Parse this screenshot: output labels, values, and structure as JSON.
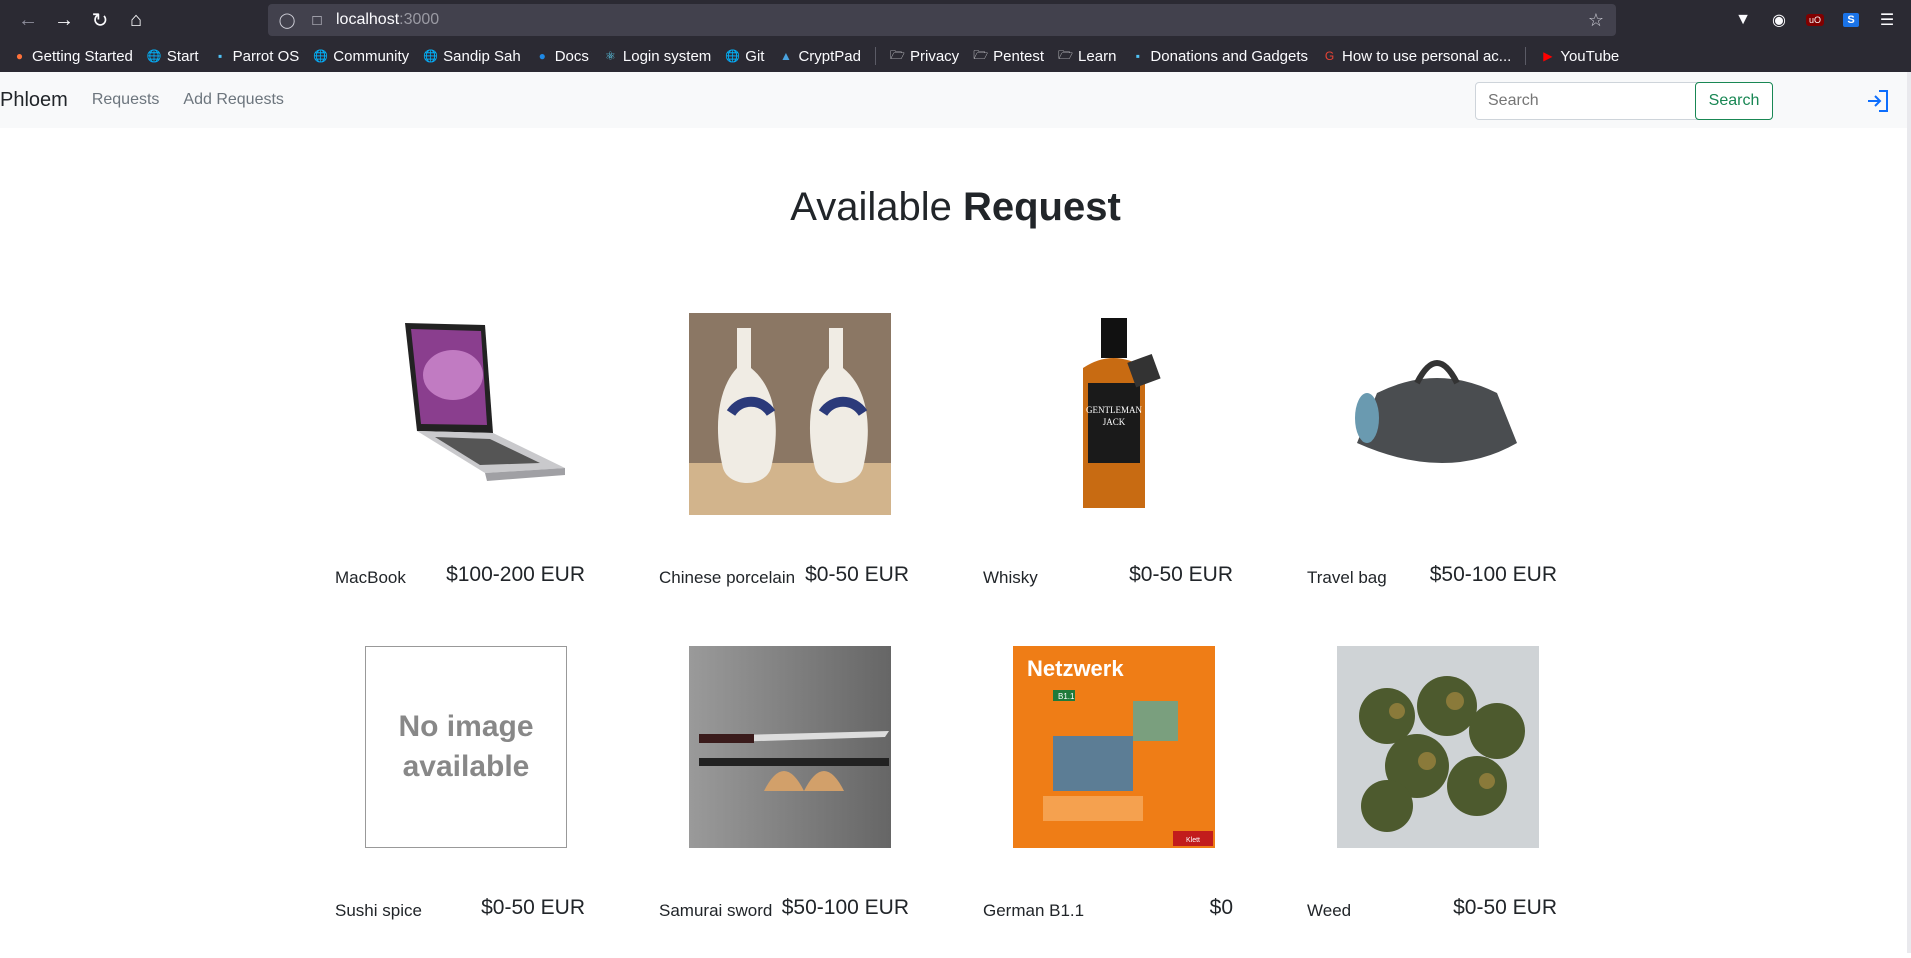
{
  "browser": {
    "url_host": "localhost",
    "url_port": ":3000",
    "bookmarks": [
      {
        "label": "Getting Started",
        "icon": "firefox-icon"
      },
      {
        "label": "Start",
        "icon": "globe-icon"
      },
      {
        "label": "Parrot OS",
        "icon": "parrot-icon"
      },
      {
        "label": "Community",
        "icon": "globe-icon"
      },
      {
        "label": "Sandip Sah",
        "icon": "globe-icon"
      },
      {
        "label": "Docs",
        "icon": "docs-icon"
      },
      {
        "label": "Login system",
        "icon": "react-icon"
      },
      {
        "label": "Git",
        "icon": "globe-icon"
      },
      {
        "label": "CryptPad",
        "icon": "cryptpad-icon"
      },
      {
        "label": "Privacy",
        "icon": "folder-icon"
      },
      {
        "label": "Pentest",
        "icon": "folder-icon"
      },
      {
        "label": "Learn",
        "icon": "folder-icon"
      },
      {
        "label": "Donations and Gadgets",
        "icon": "parrot-icon"
      },
      {
        "label": "How to use personal ac...",
        "icon": "google-icon"
      },
      {
        "label": "YouTube",
        "icon": "youtube-icon"
      }
    ]
  },
  "navbar": {
    "brand": "Phloem",
    "links": [
      "Requests",
      "Add Requests"
    ],
    "search_placeholder": "Search",
    "search_button": "Search"
  },
  "heading": {
    "light": "Available ",
    "bold": "Request"
  },
  "cards": [
    {
      "name": "MacBook",
      "price": "$100-200 EUR",
      "image": "laptop"
    },
    {
      "name": "Chinese porcelain",
      "price": "$0-50 EUR",
      "image": "vases"
    },
    {
      "name": "Whisky",
      "price": "$0-50 EUR",
      "image": "whisky"
    },
    {
      "name": "Travel bag",
      "price": "$50-100 EUR",
      "image": "bag"
    },
    {
      "name": "Sushi spice",
      "price": "$0-50 EUR",
      "image": "noimage",
      "noimage_text": "No image available"
    },
    {
      "name": "Samurai sword",
      "price": "$50-100 EUR",
      "image": "sword"
    },
    {
      "name": "German B1.1",
      "price": "$0",
      "image": "book",
      "book_title": "Netzwerk",
      "book_level": "B1.1",
      "book_publisher": "Klett"
    },
    {
      "name": "Weed",
      "price": "$0-50 EUR",
      "image": "weed"
    }
  ],
  "whisky_label": {
    "line1": "GENTLEMAN",
    "line2": "JACK"
  }
}
